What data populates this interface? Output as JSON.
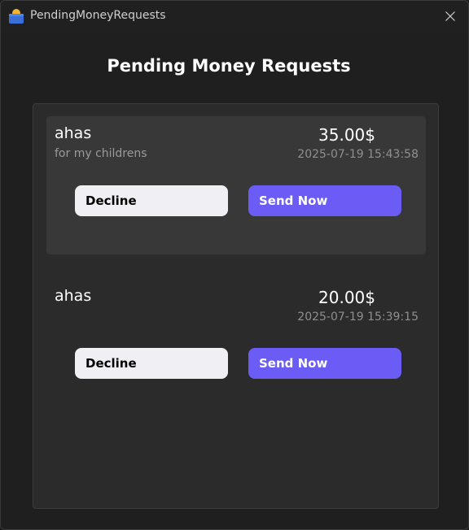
{
  "window": {
    "title": "PendingMoneyRequests"
  },
  "page": {
    "title": "Pending Money Requests"
  },
  "requests": [
    {
      "name": "ahas",
      "note": "for my childrens",
      "amount": "35.00$",
      "date": "2025-07-19 15:43:58",
      "decline_label": "Decline",
      "send_label": "Send Now",
      "selected": true
    },
    {
      "name": "ahas",
      "note": "",
      "amount": "20.00$",
      "date": "2025-07-19 15:39:15",
      "decline_label": "Decline",
      "send_label": "Send Now",
      "selected": false
    }
  ],
  "icons": {
    "app": "wallet-icon",
    "close": "close-icon"
  },
  "colors": {
    "accent": "#6b5cf6",
    "decline_button": "#f0eff4",
    "selected_card": "#383838"
  }
}
